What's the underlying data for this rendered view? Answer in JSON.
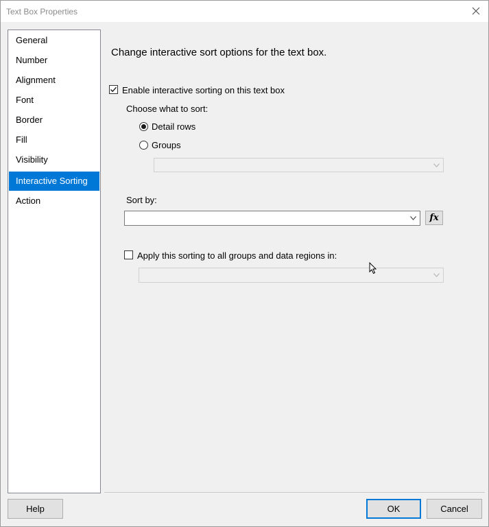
{
  "window": {
    "title": "Text Box Properties"
  },
  "nav": {
    "items": [
      {
        "label": "General"
      },
      {
        "label": "Number"
      },
      {
        "label": "Alignment"
      },
      {
        "label": "Font"
      },
      {
        "label": "Border"
      },
      {
        "label": "Fill"
      },
      {
        "label": "Visibility"
      },
      {
        "label": "Interactive Sorting"
      },
      {
        "label": "Action"
      }
    ],
    "selected": "Interactive Sorting"
  },
  "content": {
    "heading": "Change interactive sort options for the text box.",
    "enable_sort": {
      "label": "Enable interactive sorting on this text box",
      "checked": true
    },
    "choose_label": "Choose what to sort:",
    "options": {
      "detail_rows": {
        "label": "Detail rows",
        "selected": true
      },
      "groups": {
        "label": "Groups",
        "selected": false
      }
    },
    "groups_combo": {
      "value": "",
      "enabled": false
    },
    "sort_by": {
      "label": "Sort by:",
      "value": ""
    },
    "fx_label": "fx",
    "apply_all": {
      "label": "Apply this sorting to all groups and data regions in:",
      "checked": false
    },
    "scope_combo": {
      "value": "",
      "enabled": false
    }
  },
  "buttons": {
    "help": "Help",
    "ok": "OK",
    "cancel": "Cancel"
  }
}
